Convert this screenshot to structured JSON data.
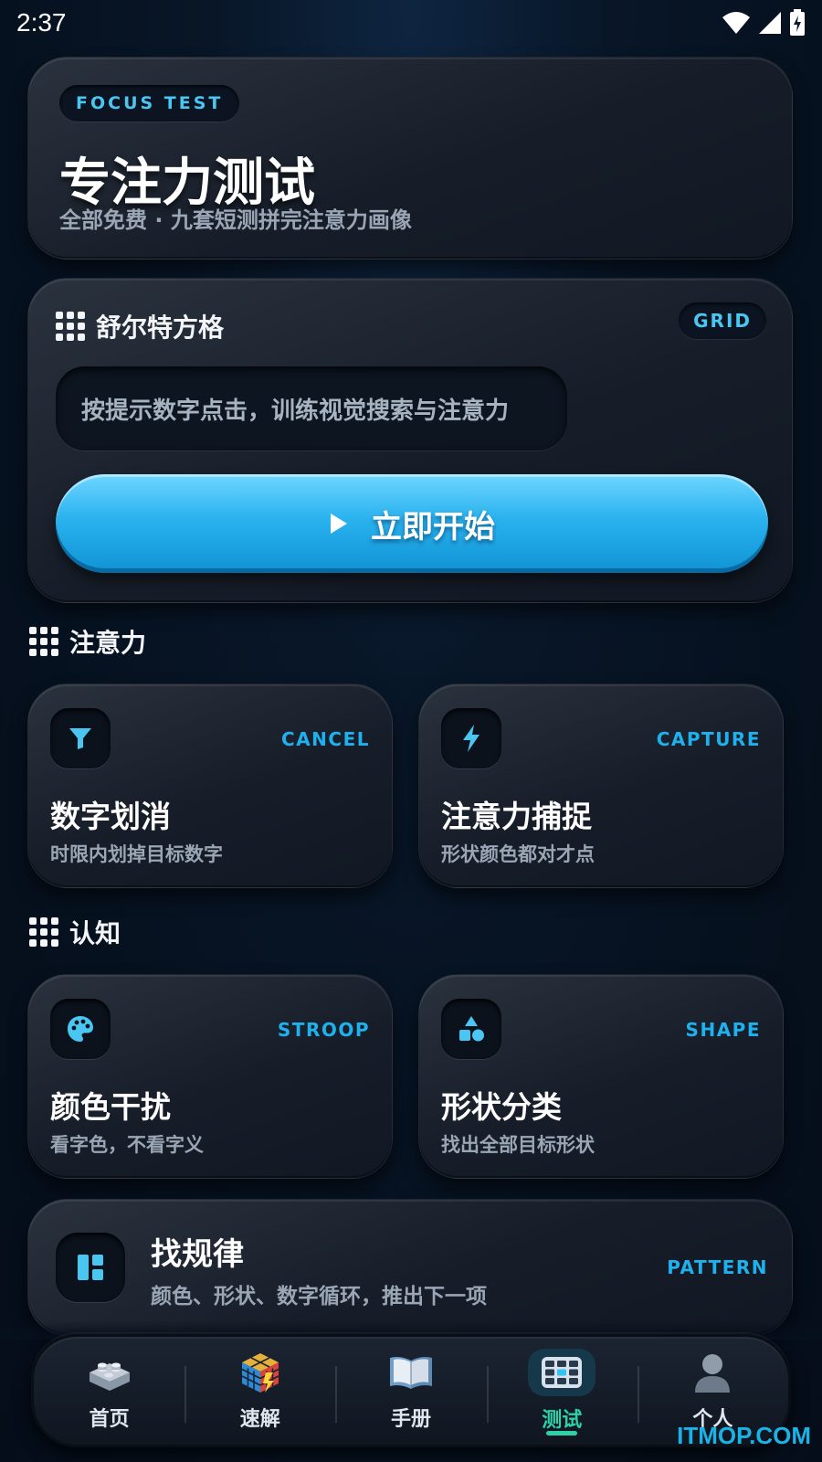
{
  "status_bar": {
    "time": "2:37"
  },
  "hero": {
    "badge": "FOCUS TEST",
    "title": "专注力测试",
    "subtitle": "全部免费 · 九套短测拼完注意力画像"
  },
  "grid_card": {
    "title": "舒尔特方格",
    "badge": "GRID",
    "hint": "按提示数字点击，训练视觉搜索与注意力",
    "start_label": "立即开始"
  },
  "sections": {
    "attention": {
      "title": "注意力"
    },
    "cognition": {
      "title": "认知"
    }
  },
  "tiles": {
    "cancel": {
      "tag": "CANCEL",
      "title": "数字划消",
      "subtitle": "时限内划掉目标数字",
      "icon": "filter-icon"
    },
    "capture": {
      "tag": "CAPTURE",
      "title": "注意力捕捉",
      "subtitle": "形状颜色都对才点",
      "icon": "lightning-icon"
    },
    "stroop": {
      "tag": "STROOP",
      "title": "颜色干扰",
      "subtitle": "看字色，不看字义",
      "icon": "palette-icon"
    },
    "shape": {
      "tag": "SHAPE",
      "title": "形状分类",
      "subtitle": "找出全部目标形状",
      "icon": "shapes-icon"
    }
  },
  "pattern": {
    "title": "找规律",
    "subtitle": "颜色、形状、数字循环，推出下一项",
    "tag": "PATTERN",
    "icon": "layout-icon"
  },
  "nav": {
    "items": [
      {
        "label": "首页",
        "icon": "lego-brick-icon"
      },
      {
        "label": "速解",
        "icon": "rubiks-cube-icon"
      },
      {
        "label": "手册",
        "icon": "book-icon"
      },
      {
        "label": "测试",
        "icon": "grid-keypad-icon",
        "active": true
      },
      {
        "label": "个人",
        "icon": "person-icon"
      }
    ]
  },
  "watermark": "ITMOP.COM",
  "colors": {
    "accent": "#1fb1ee",
    "active": "#2fd0a8",
    "button": "#2ab2ef"
  }
}
